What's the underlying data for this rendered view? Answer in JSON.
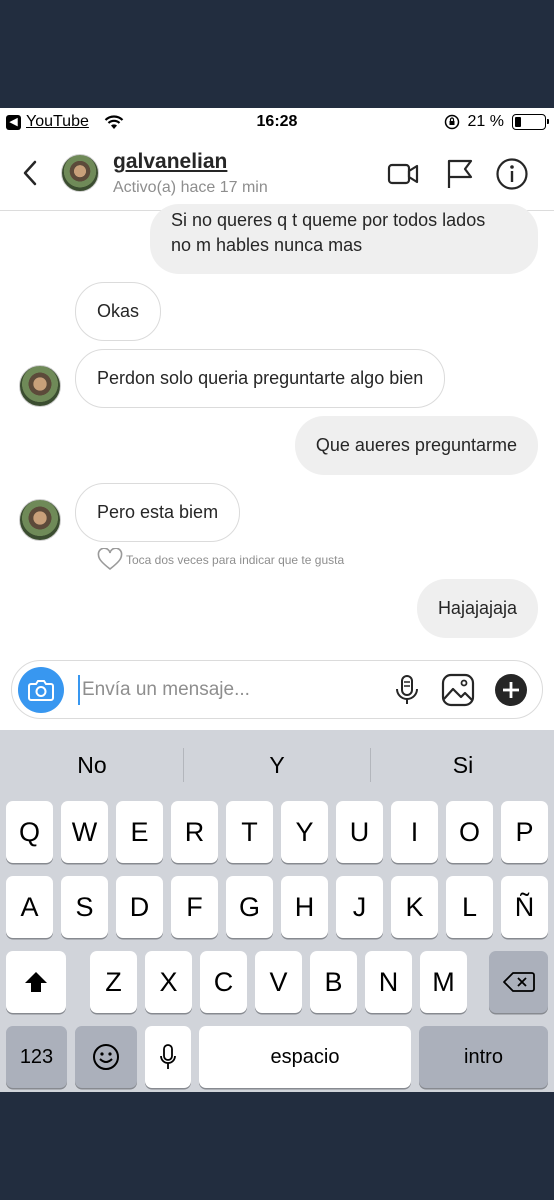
{
  "status_bar": {
    "back_app": "YouTube",
    "time": "16:28",
    "battery": "21 %",
    "battery_level": 0.21
  },
  "header": {
    "username": "galvanelian",
    "activity": "Activo(a) hace 17 min"
  },
  "messages": [
    {
      "direction": "out",
      "text_lines": [
        "Si no queres q t queme por todos lados",
        "no m hables nunca mas"
      ]
    },
    {
      "direction": "in",
      "text": "Okas",
      "avatar": false
    },
    {
      "direction": "in",
      "text": "Perdon solo queria preguntarte algo bien",
      "avatar": true
    },
    {
      "direction": "out",
      "text": "Que aueres preguntarme"
    },
    {
      "direction": "in",
      "text": "Pero esta biem",
      "avatar": true
    },
    {
      "direction": "out",
      "text": "Hajajajaja"
    }
  ],
  "like_hint": "Toca dos veces para indicar que te gusta",
  "composer": {
    "placeholder": "Envía un mensaje..."
  },
  "keyboard": {
    "suggestions": [
      "No",
      "Y",
      "Si"
    ],
    "row1": [
      "Q",
      "W",
      "E",
      "R",
      "T",
      "Y",
      "U",
      "I",
      "O",
      "P"
    ],
    "row2": [
      "A",
      "S",
      "D",
      "F",
      "G",
      "H",
      "J",
      "K",
      "L",
      "Ñ"
    ],
    "row3": [
      "Z",
      "X",
      "C",
      "V",
      "B",
      "N",
      "M"
    ],
    "numbers_label": "123",
    "space_label": "espacio",
    "return_label": "intro"
  },
  "colors": {
    "accent": "#3897f0",
    "background_frame": "#222d3f",
    "keyboard_bg": "#d1d4da"
  }
}
